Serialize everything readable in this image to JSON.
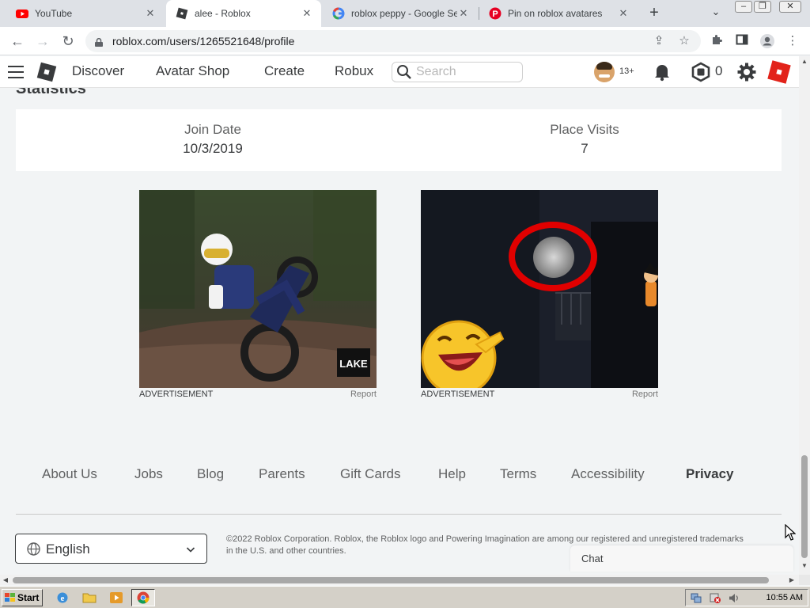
{
  "browser": {
    "tabs": [
      {
        "title": "YouTube",
        "color": "#ff0000"
      },
      {
        "title": "alee - Roblox",
        "color": "#393b3d"
      },
      {
        "title": "roblox peppy - Google Search",
        "color": "#4285f4"
      },
      {
        "title": "Pin on roblox avatares",
        "color": "#e60023"
      }
    ],
    "url": "roblox.com/users/1265521648/profile"
  },
  "navbar": {
    "links": [
      "Discover",
      "Avatar Shop",
      "Create",
      "Robux"
    ],
    "search_placeholder": "Search",
    "age_label": "13+",
    "robux_count": "0"
  },
  "statistics": {
    "heading": "Statistics",
    "items": [
      {
        "label": "Join Date",
        "value": "10/3/2019"
      },
      {
        "label": "Place Visits",
        "value": "7"
      }
    ]
  },
  "ads": [
    {
      "label": "ADVERTISEMENT",
      "report": "Report",
      "brand_text": "LAKE"
    },
    {
      "label": "ADVERTISEMENT",
      "report": "Report"
    }
  ],
  "footer": {
    "links": [
      "About Us",
      "Jobs",
      "Blog",
      "Parents",
      "Gift Cards",
      "Help",
      "Terms",
      "Accessibility",
      "Privacy"
    ],
    "language": "English",
    "copyright": "©2022 Roblox Corporation. Roblox, the Roblox logo and Powering Imagination are among our registered and unregistered trademarks in the U.S. and other countries."
  },
  "chat": {
    "label": "Chat"
  },
  "taskbar": {
    "start_label": "Start",
    "clock": "10:55 AM"
  },
  "colors": {
    "roblox_red": "#e2231a",
    "ad_circle": "#e00000"
  }
}
